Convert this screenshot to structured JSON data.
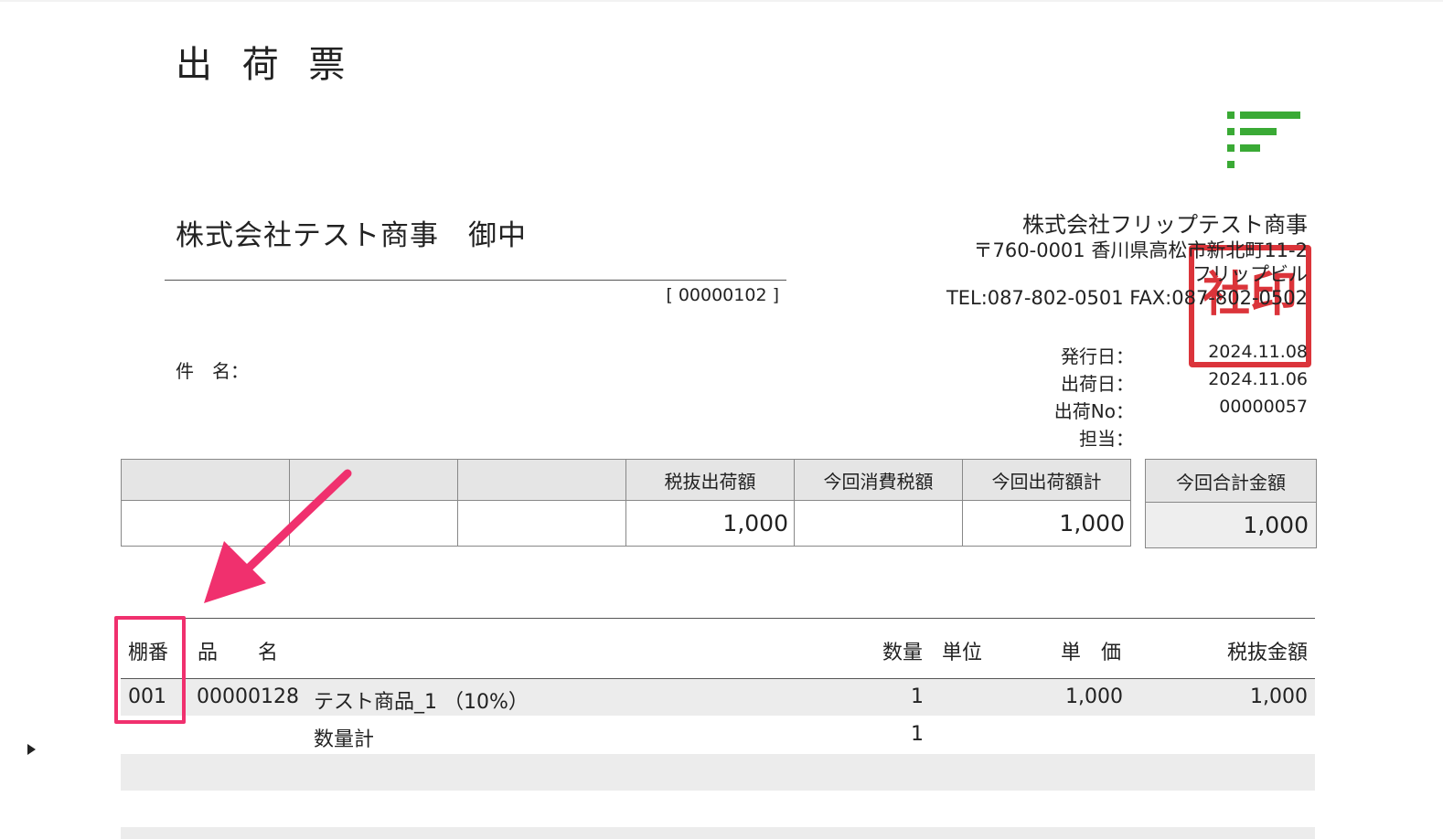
{
  "document": {
    "title": "出 荷 票",
    "customer": "株式会社テスト商事　御中",
    "doc_number": "[ 00000102 ]",
    "subject_label": "件　名："
  },
  "company": {
    "name": "株式会社フリップテスト商事",
    "address_line1": "〒760-0001 香川県高松市新北町11-2",
    "address_line2": "フリップビル",
    "contact": "TEL:087-802-0501 FAX:087-802-0502",
    "seal_text": "社印",
    "logo_color": "#3aaa35"
  },
  "meta": [
    {
      "label": "発行日：",
      "value": "2024.11.08"
    },
    {
      "label": "出荷日：",
      "value": "2024.11.06"
    },
    {
      "label": "出荷No：",
      "value": "00000057"
    },
    {
      "label": "担当：",
      "value": ""
    }
  ],
  "summary": {
    "headers": [
      "",
      "",
      "",
      "税抜出荷額",
      "今回消費税額",
      "今回出荷額計"
    ],
    "values": [
      "",
      "",
      "",
      "1,000",
      "",
      "1,000"
    ],
    "total_header": "今回合計金額",
    "total_value": "1,000"
  },
  "details": {
    "headers": {
      "shelf": "棚番",
      "item": "品　　名",
      "qty": "数量",
      "unit": "単位",
      "price": "単　価",
      "amount": "税抜金額"
    },
    "rows": [
      {
        "shelf": "001",
        "code": "00000128",
        "name": "テスト商品_1 （10%）",
        "qty": "1",
        "price": "1,000",
        "amount": "1,000"
      }
    ],
    "qty_total_label": "数量計",
    "qty_total": "1"
  },
  "annotation": {
    "highlight_color": "#f0306e"
  }
}
